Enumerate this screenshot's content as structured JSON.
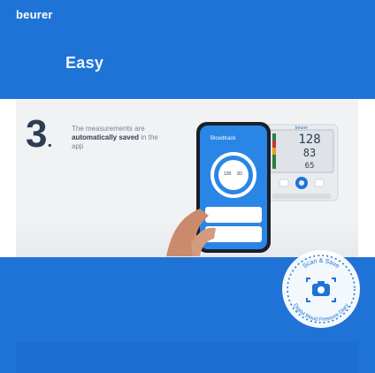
{
  "brand": {
    "name": "beurer"
  },
  "header": {
    "title": "Easy"
  },
  "step": {
    "number": "3",
    "text_pre": "The measurements are ",
    "text_bold1": "automatically saved",
    "text_post": " in the app"
  },
  "device": {
    "brand_label": "beurer",
    "systolic": "128",
    "diastolic": "83",
    "pulse": "65"
  },
  "app_screen": {
    "title": "Bloodtrack",
    "left_value": "128",
    "right_value": "83"
  },
  "badge": {
    "arc_text": "Scan & Save",
    "bottom_text": "Digital Blood Pressure Diary"
  },
  "colors": {
    "brand_blue": "#1f73d6",
    "panel_grey": "#f1f2f4",
    "number_navy": "#2d3e54"
  }
}
